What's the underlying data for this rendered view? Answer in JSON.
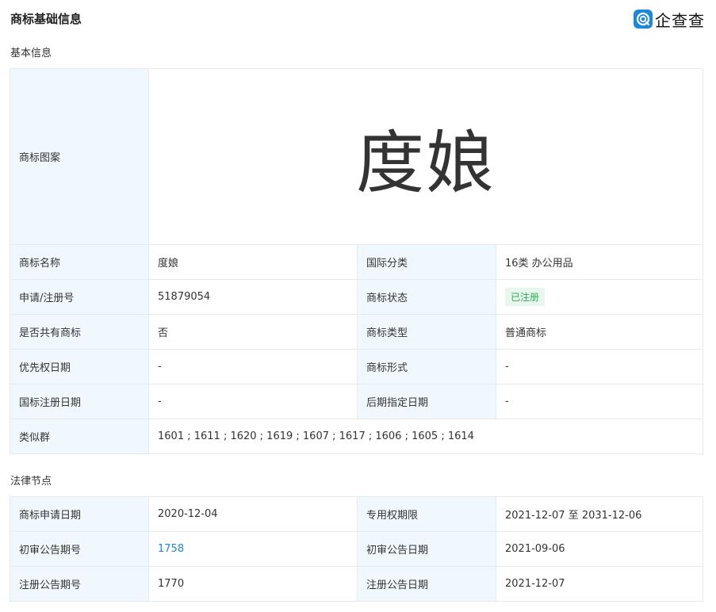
{
  "header": {
    "title": "商标基础信息",
    "logo_text": "企查查",
    "logo_icon": "qichacha-logo-icon"
  },
  "basic": {
    "section_title": "基本信息",
    "mark_image_label": "商标图案",
    "mark_image_text": "度娘",
    "rows": [
      {
        "l1": "商标名称",
        "v1": "度娘",
        "l2": "国际分类",
        "v2": "16类 办公用品"
      },
      {
        "l1": "申请/注册号",
        "v1": "51879054",
        "l2": "商标状态",
        "v2": "已注册"
      },
      {
        "l1": "是否共有商标",
        "v1": "否",
        "l2": "商标类型",
        "v2": "普通商标"
      },
      {
        "l1": "优先权日期",
        "v1": "-",
        "l2": "商标形式",
        "v2": "-"
      },
      {
        "l1": "国标注册日期",
        "v1": "-",
        "l2": "后期指定日期",
        "v2": "-"
      }
    ],
    "similar_label": "类似群",
    "similar_value": "1601 ; 1611 ; 1620 ; 1619 ; 1607 ; 1617 ; 1606 ; 1605 ; 1614"
  },
  "legal": {
    "section_title": "法律节点",
    "rows": [
      {
        "l1": "商标申请日期",
        "v1": "2020-12-04",
        "l2": "专用权期限",
        "v2": "2021-12-07 至 2031-12-06"
      },
      {
        "l1": "初审公告期号",
        "v1": "1758",
        "l2": "初审公告日期",
        "v2": "2021-09-06"
      },
      {
        "l1": "注册公告期号",
        "v1": "1770",
        "l2": "注册公告日期",
        "v2": "2021-12-07"
      }
    ]
  },
  "colors": {
    "label_bg": "#f1f8fd",
    "border": "#e4ecf3",
    "link": "#1e88d8",
    "badge_text": "#2eaa5c",
    "badge_bg": "#e8f7ee"
  }
}
